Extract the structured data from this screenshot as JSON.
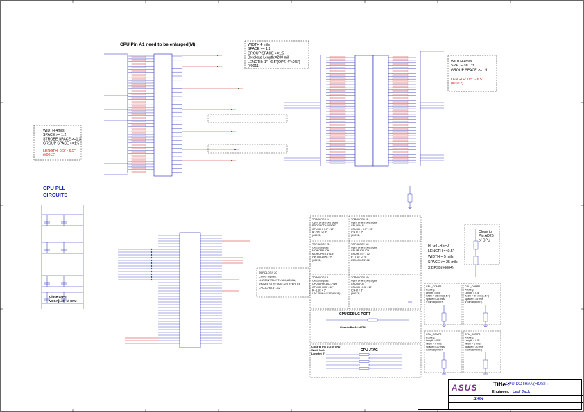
{
  "page": {
    "title_main": "CPU Pin A1 need to be enlarged(M)",
    "cpu_pll_title": "CPU PLL",
    "cpu_circuits_title": "CIRCUITS",
    "debug_port_title": "CPU DEBUG PORT",
    "debug_port_note": "Close to Pin A6 of CPU",
    "jtag_title": "CPU JTAG",
    "jtag_note": "Close to Pin D12 of CPU Width 5mils Length < 2\"",
    "pll_note": "Close to Pin VCCA[1..3] of CPU",
    "border_markers": [
      "1",
      "2",
      "3",
      "4",
      "5",
      "6",
      "7",
      "8",
      "A",
      "B",
      "C",
      "D"
    ]
  },
  "notes": {
    "width_spacing_top": [
      "WIDTH 4 mils",
      "SPACE >= 1:2",
      "GROUP SPACE >=1:5",
      "Breakout Length:=200 mil",
      "LENGTH: 1\" - 6.5\"(OPT. 4\"<0.5\")",
      "(#0011)"
    ],
    "width_strobe": [
      "WIDTH 4mils",
      "SPACE >= 1:2",
      "STROBE SPACE >=1:3",
      "GROUP SPACE >=1:5"
    ],
    "length_strobe": [
      "LENGTH: 0.5\" - 6.5\"",
      "(#0012)"
    ],
    "width_right": [
      "WIDTH 4mils",
      "SPACE >= 1:3",
      "GROUP SPACE >=1:5"
    ],
    "length_right": [
      "LENGTH: 0.5\" - 6.5\"",
      "(#0012)"
    ],
    "gtl_ref": [
      "H_GTLREF0",
      "LENGTH =<0.5\"",
      "WIDTH = 5 mils",
      "SPACE >= 25 mils",
      "X:BPSB(#0004)"
    ],
    "close_to_pin": [
      "Close to",
      "Pin AD26",
      "of CPU"
    ],
    "topology_2c": [
      "TOPOLOGY 2C",
      "CMOS Signals:",
      "LINT0/INTR,LINT1/NMI,A20M#,",
      "IGNNE#,SLP#,SMI#,and STPCLK#",
      "CPU-ICH 0.5\" - 12\""
    ],
    "topo_1a": [
      "TOPOLOGY 1A",
      "Open Drain (OD) Signal",
      "PROCHOT#: Y PORT",
      "CPU-ICH: 0.5\" - 12\"",
      "R: CPU >= 3\"",
      "(#0013)"
    ],
    "topo_1b": [
      "TOPOLOGY 1B",
      "Open Drain (OD) Signal",
      "CPU-ICH R",
      "CPU-ICH: 0.5\" - 12\"",
      "ICH R < 3\"",
      "(#0013)"
    ],
    "topo_2b": [
      "TOPOLOGY 2B",
      "CMOS Signals",
      "MCH-CPU-ICH:",
      "MCH-CPU:0.5\"-6.5\"",
      "CPU-ICH:0.5\"-12\"",
      "(#0013)"
    ],
    "topo_1c": [
      "TOPOLOGY 1C",
      "Open Drain (OD) Signal",
      "CPU-R-ICH-ICH",
      "CPU-R: 0.5\" - 12\"",
      "R - LSC >= 3\"",
      "LSC-ICH:0.5\"-12\""
    ],
    "topo_3": [
      "TOPOLOGY 3",
      "CMOS Signals",
      "CPU-ICH R-LSC-FWH",
      "CPU-ICH:0.5\" - 12\"",
      "R - LSC < 3\"",
      "LSC-FWH:0.5\"-8\"(#0013)"
    ],
    "topo_1d": [
      "TOPOLOGY 1D",
      "Open Drain (OD) Signal",
      "CPU-ICH-R",
      "CPU-ICH:0.5\" - 12\"",
      "ICH-R < 3\"",
      "(#0013)"
    ],
    "comp3": [
      "CPU_COMP3",
      "Routing:",
      "Length = 0.5\"",
      "Width = 25 mils(1.5:4)",
      "Space>= 25 mils",
      "X:BPSB(#0007)"
    ],
    "comp1": [
      "CPU_COMP1",
      "Routing:",
      "Length = 0.5\"",
      "Width = 20 mils(1.5:4)",
      "Space>= 25 mils",
      "X:BPSB(#0007)"
    ],
    "comp2": [
      "CPU_COMP2",
      "Routing:",
      "Length = 0.5\"",
      "Width = 6 mils",
      "Space>= 20 mils",
      "X:BPSB(#0007)"
    ],
    "comp0": [
      "CPU_COMP0",
      "Routing:",
      "Length = 0.5\"",
      "Width = 6 mils",
      "Space>= 20 mils",
      "X:BPSB(#0007)"
    ]
  },
  "title_block": {
    "logo": "ASUS",
    "title_label": "Title :",
    "title_value": "CPU-DOTHAN(HOST)",
    "engineer_label": "Engineer:",
    "engineer_value": "Leo/ Jack",
    "size": "A3G"
  },
  "colors": {
    "wire": "#1c23b4",
    "net": "#d21a1a",
    "ink": "#000000",
    "logo": "#7a2b8a"
  }
}
